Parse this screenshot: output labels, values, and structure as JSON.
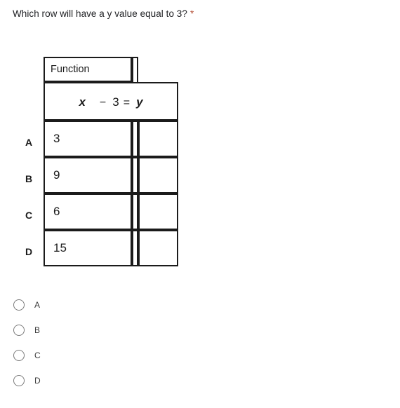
{
  "question": {
    "text": "Which row will have a y value equal to 3?",
    "required_marker": "*",
    "required_marker_color": "#b5523a"
  },
  "figure": {
    "header_label": "Function",
    "formula": {
      "full_text": "x − 3 = y",
      "left_variable": "x",
      "operator": "−",
      "constant": "3",
      "equals": "=",
      "right_variable": "y"
    },
    "columns": [
      "x",
      "y"
    ],
    "rows": [
      {
        "label": "A",
        "x": "3",
        "y": ""
      },
      {
        "label": "B",
        "x": "9",
        "y": ""
      },
      {
        "label": "C",
        "x": "6",
        "y": ""
      },
      {
        "label": "D",
        "x": "15",
        "y": ""
      }
    ]
  },
  "options": [
    {
      "label": "A",
      "selected": false
    },
    {
      "label": "B",
      "selected": false
    },
    {
      "label": "C",
      "selected": false
    },
    {
      "label": "D",
      "selected": false
    }
  ]
}
